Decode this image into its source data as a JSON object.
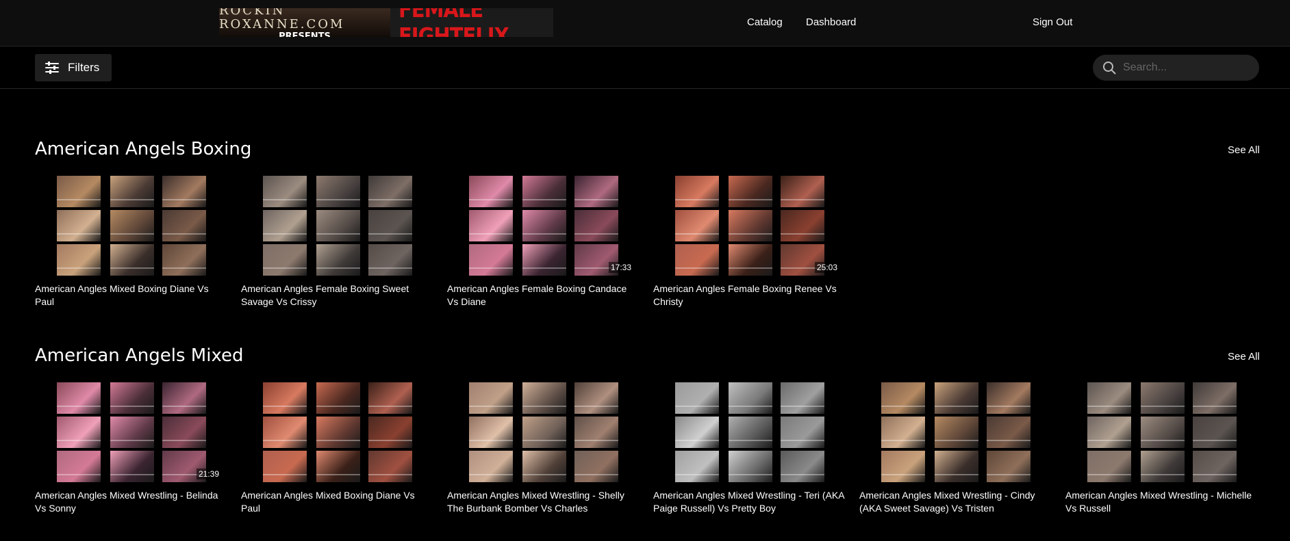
{
  "header": {
    "logo_line1": "ROCKIN ROXANNE.COM",
    "logo_line2": "PRESENTS",
    "logo_brand": "FEMALE FIGHTFLIX",
    "nav_catalog": "Catalog",
    "nav_dashboard": "Dashboard",
    "nav_signout": "Sign Out"
  },
  "toolbar": {
    "filters_label": "Filters",
    "search_placeholder": "Search..."
  },
  "sections": [
    {
      "title": "American Angels Boxing",
      "see_all": "See All",
      "cards": [
        {
          "title": "American Angles Mixed Boxing Diane Vs Paul",
          "duration": ""
        },
        {
          "title": "American Angles Female Boxing Sweet Savage Vs Crissy",
          "duration": ""
        },
        {
          "title": "American Angles Female Boxing Candace Vs Diane",
          "duration": "17:33"
        },
        {
          "title": "American Angles Female Boxing Renee Vs Christy",
          "duration": "25:03"
        }
      ]
    },
    {
      "title": "American Angels Mixed",
      "see_all": "See All",
      "cards": [
        {
          "title": "American Angles Mixed Wrestling - Belinda Vs Sonny",
          "duration": "21:39"
        },
        {
          "title": "American Angles Mixed Boxing Diane Vs Paul",
          "duration": ""
        },
        {
          "title": "American Angles Mixed Wrestling - Shelly The Burbank Bomber Vs Charles",
          "duration": ""
        },
        {
          "title": "American Angles Mixed Wrestling - Teri (AKA Paige Russell) Vs Pretty Boy",
          "duration": ""
        },
        {
          "title": "American Angles Mixed Wrestling - Cindy (AKA Sweet Savage) Vs Tristen",
          "duration": ""
        },
        {
          "title": "American Angles Mixed Wrestling - Michelle Vs Russell",
          "duration": ""
        }
      ]
    }
  ]
}
